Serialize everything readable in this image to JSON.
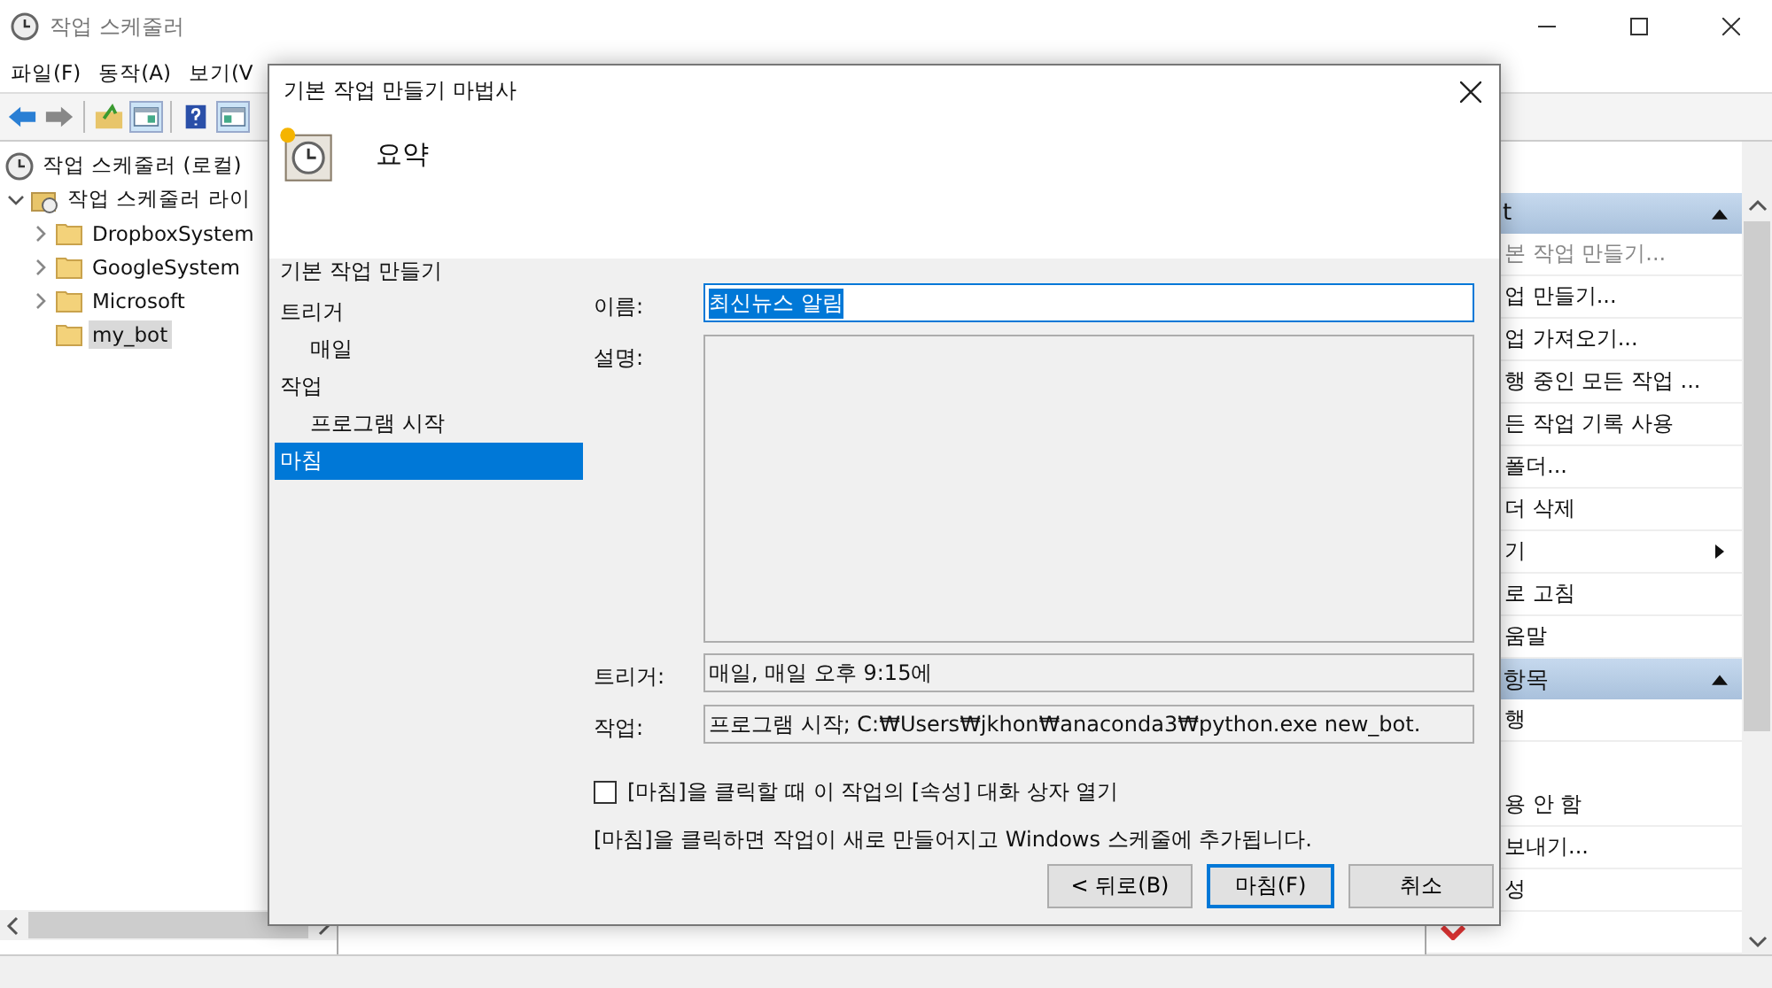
{
  "window": {
    "title": "작업 스케줄러"
  },
  "menu": [
    "파일(F)",
    "동작(A)",
    "보기(V"
  ],
  "tree": {
    "root": "작업 스케줄러 (로컬)",
    "library": {
      "label": "작업 스케줄러 라이",
      "expanded": true,
      "children": [
        {
          "label": "DropboxSystem",
          "selected": false
        },
        {
          "label": "GoogleSystem",
          "selected": false
        },
        {
          "label": "Microsoft",
          "selected": false
        },
        {
          "label": "my_bot",
          "selected": true
        }
      ]
    }
  },
  "actions": [
    {
      "header": "t",
      "items": [
        {
          "label": "본 작업 만들기...",
          "disabled": true,
          "submenu": false
        },
        {
          "label": "업 만들기...",
          "disabled": false,
          "submenu": false
        },
        {
          "label": "업 가져오기...",
          "disabled": false,
          "submenu": false
        },
        {
          "label": "행 중인 모든 작업 ...",
          "disabled": false,
          "submenu": false
        },
        {
          "label": "든 작업 기록 사용",
          "disabled": false,
          "submenu": false
        },
        {
          "label": "폴더...",
          "disabled": false,
          "submenu": false
        },
        {
          "label": "더 삭제",
          "disabled": false,
          "submenu": false
        },
        {
          "label": "기",
          "disabled": false,
          "submenu": true
        },
        {
          "label": "로 고침",
          "disabled": false,
          "submenu": false
        },
        {
          "label": "움말",
          "disabled": false,
          "submenu": false
        }
      ]
    },
    {
      "header": "항목",
      "items": [
        {
          "label": "행",
          "disabled": false,
          "submenu": false
        },
        {
          "label": "용 안 함",
          "disabled": false,
          "submenu": false
        },
        {
          "label": "보내기...",
          "disabled": false,
          "submenu": false
        },
        {
          "label": "성",
          "disabled": false,
          "submenu": false
        }
      ]
    }
  ],
  "dialog": {
    "title": "기본 작업 만들기 마법사",
    "heading": "요약",
    "nav_title": "기본 작업 만들기",
    "steps": [
      {
        "label": "트리거",
        "selected": false,
        "children": [
          {
            "label": "매일",
            "selected": false
          }
        ]
      },
      {
        "label": "작업",
        "selected": false,
        "children": [
          {
            "label": "프로그램 시작",
            "selected": false
          }
        ]
      },
      {
        "label": "마침",
        "selected": true
      }
    ],
    "fields": [
      {
        "kind": "text",
        "label": "이름:",
        "value": "최신뉴스 알림"
      },
      {
        "kind": "textarea",
        "label": "설명:"
      },
      {
        "kind": "readonly",
        "label": "트리거:",
        "value": "매일, 매일 오후 9:15에"
      },
      {
        "kind": "readonly",
        "label": "작업:",
        "value": "프로그램 시작; C:₩Users₩jkhon₩anaconda3₩python.exe new_bot."
      }
    ],
    "open_properties": {
      "label": "[마침]을 클릭할 때 이 작업의 [속성] 대화 상자 열기",
      "checked": false
    },
    "note": "[마침]을 클릭하면 작업이 새로 만들어지고 Windows 스케줄에 추가됩니다.",
    "buttons": [
      {
        "label": "< 뒤로(B)",
        "default": false
      },
      {
        "label": "마침(F)",
        "default": true
      },
      {
        "label": "취소",
        "default": false
      }
    ]
  }
}
